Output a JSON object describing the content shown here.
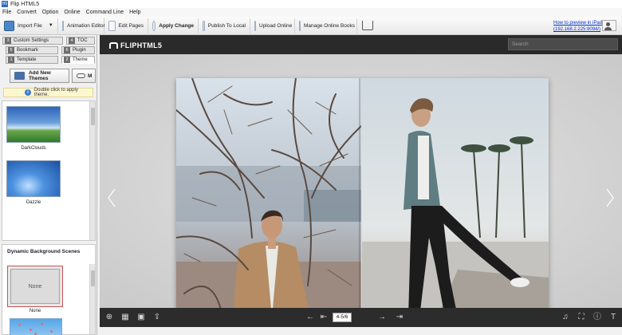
{
  "window": {
    "title": "Flip HTML5"
  },
  "menu": [
    "File",
    "Convert",
    "Option",
    "Online",
    "Command Line",
    "Help"
  ],
  "toolbar": {
    "import_file": "Import File",
    "animation_editor": "Animation Editor",
    "edit_pages": "Edit Pages",
    "apply_change": "Apply Change",
    "publish_local": "Publish To Local",
    "upload_online": "Upload Online",
    "manage_books": "Manage Online Books",
    "preview_link_line1": "How to preview in iPad",
    "preview_link_line2": "(192.168.2.225:9094/)"
  },
  "left_panel": {
    "tabs": [
      {
        "num": "3",
        "label": "Custom Settings"
      },
      {
        "num": "4",
        "label": "TOC"
      },
      {
        "num": "5",
        "label": "Bookmark"
      },
      {
        "num": "6",
        "label": "Plugin"
      },
      {
        "num": "1",
        "label": "Template"
      },
      {
        "num": "2",
        "label": "Theme"
      }
    ],
    "add_themes": "Add New Themes",
    "second_button": "M",
    "hint": "Double click to apply theme.",
    "themes": [
      {
        "name": "DarkClouds"
      },
      {
        "name": "Dazzle"
      }
    ],
    "scenes_header": "Dynamic Background Scenes",
    "scene_none_inner": "None",
    "scene_none_caption": "None"
  },
  "viewer": {
    "logo": "FLIPHTML5",
    "search_placeholder": "Search",
    "page_indicator": "4-5/6"
  },
  "colors": {
    "viewer_bar": "#2a2a2a",
    "link": "#0033cc",
    "scene_selected_border": "#c65353"
  }
}
